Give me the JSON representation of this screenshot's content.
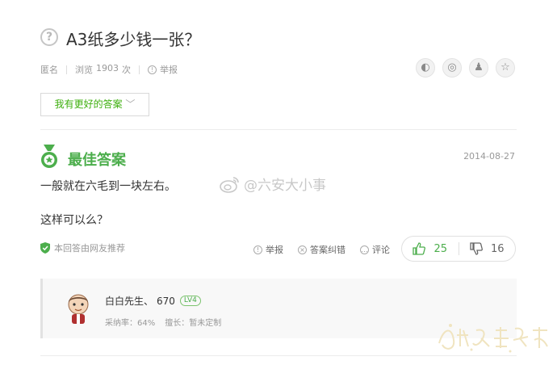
{
  "question": {
    "title": "A3纸多少钱一张？",
    "icon": "question-circle-icon"
  },
  "meta": {
    "author": "匿名",
    "views_label": "浏览",
    "views_count": "1903",
    "views_unit": "次",
    "report": "举报"
  },
  "share_icons": [
    "wechat-icon",
    "weibo-icon",
    "qq-icon",
    "star-icon"
  ],
  "better_answer_button": "我有更好的答案",
  "best_answer": {
    "title": "最佳答案",
    "date": "2014-08-27",
    "lines": [
      "一般就在六毛到一块左右。",
      "这样可以么？"
    ],
    "recommend": "本回答由网友推荐"
  },
  "watermark": {
    "text": "@六安大小事"
  },
  "actions": {
    "report": "举报",
    "correct": "答案纠错",
    "comment": "评论"
  },
  "votes": {
    "up": "25",
    "down": "16"
  },
  "user": {
    "name": "白白先生、",
    "score": "670",
    "level": "LV4",
    "adopt_rate": "采纳率：64%",
    "specialty": "擅长：暂未定制"
  },
  "colors": {
    "accent": "#4cae4c",
    "text": "#333333",
    "muted": "#999999",
    "border": "#e0e0e0"
  }
}
